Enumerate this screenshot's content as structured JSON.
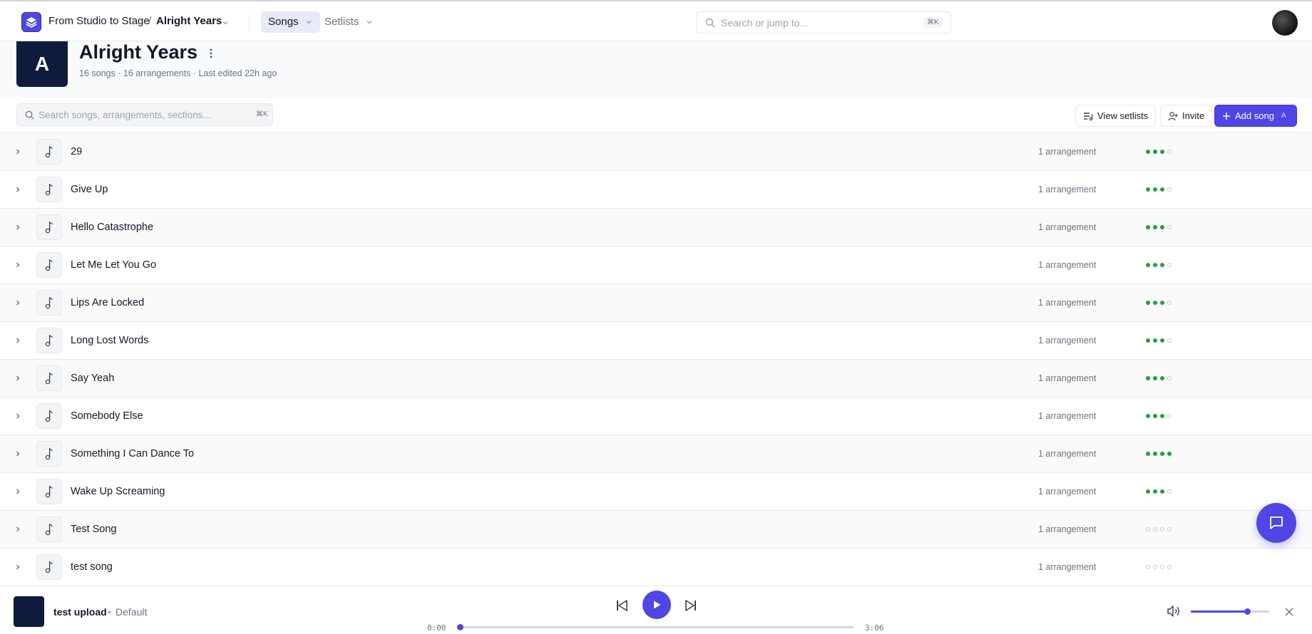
{
  "topbar": {
    "org": "From Studio to Stage",
    "separator": "/",
    "project": "Alright Years",
    "tabs": [
      {
        "label": "Songs",
        "active": true
      },
      {
        "label": "Setlists",
        "active": false
      }
    ],
    "search_placeholder": "Search or jump to...",
    "search_shortcut": "⌘K"
  },
  "project_header": {
    "tile_letter": "A",
    "title": "Alright Years",
    "meta": "16 songs · 16 arrangements · Last edited 22h ago"
  },
  "toolbar": {
    "search_placeholder": "Search songs, arrangements, sections...",
    "search_shortcut": "⌘K",
    "view_setlists": "View setlists",
    "invite": "Invite",
    "add_song": "Add song",
    "add_song_shortcut": "A"
  },
  "songs": [
    {
      "title": "29",
      "arrangements": "1 arrangement",
      "progress": [
        1,
        1,
        1,
        0
      ]
    },
    {
      "title": "Give Up",
      "arrangements": "1 arrangement",
      "progress": [
        1,
        1,
        1,
        0
      ]
    },
    {
      "title": "Hello Catastrophe",
      "arrangements": "1 arrangement",
      "progress": [
        1,
        1,
        1,
        0
      ]
    },
    {
      "title": "Let Me Let You Go",
      "arrangements": "1 arrangement",
      "progress": [
        1,
        1,
        1,
        0
      ]
    },
    {
      "title": "Lips Are Locked",
      "arrangements": "1 arrangement",
      "progress": [
        1,
        1,
        1,
        0
      ]
    },
    {
      "title": "Long Lost Words",
      "arrangements": "1 arrangement",
      "progress": [
        1,
        1,
        1,
        0
      ]
    },
    {
      "title": "Say Yeah",
      "arrangements": "1 arrangement",
      "progress": [
        1,
        1,
        1,
        0
      ]
    },
    {
      "title": "Somebody Else",
      "arrangements": "1 arrangement",
      "progress": [
        1,
        1,
        1,
        0
      ]
    },
    {
      "title": "Something I Can Dance To",
      "arrangements": "1 arrangement",
      "progress": [
        1,
        1,
        1,
        1
      ]
    },
    {
      "title": "Wake Up Screaming",
      "arrangements": "1 arrangement",
      "progress": [
        1,
        1,
        1,
        0
      ]
    },
    {
      "title": "Test Song",
      "arrangements": "1 arrangement",
      "progress": [
        0,
        0,
        0,
        0
      ]
    },
    {
      "title": "test song",
      "arrangements": "1 arrangement",
      "progress": [
        0,
        0,
        0,
        0
      ]
    }
  ],
  "player": {
    "track": "test upload",
    "bullet": "•",
    "arrangement": "Default",
    "elapsed": "0:00",
    "duration": "3:06",
    "position_fraction": 0.0,
    "volume_fraction": 0.72
  },
  "icons": {
    "logo": "layers-icon",
    "song": "music-note-icon",
    "expand": "chevron-right-icon",
    "chat": "chat-bubble-icon",
    "volume": "speaker-icon",
    "close": "close-icon"
  },
  "colors": {
    "accent": "#4f46e5",
    "progress_on": "#22a040",
    "tile_bg": "#0f1b3d"
  }
}
